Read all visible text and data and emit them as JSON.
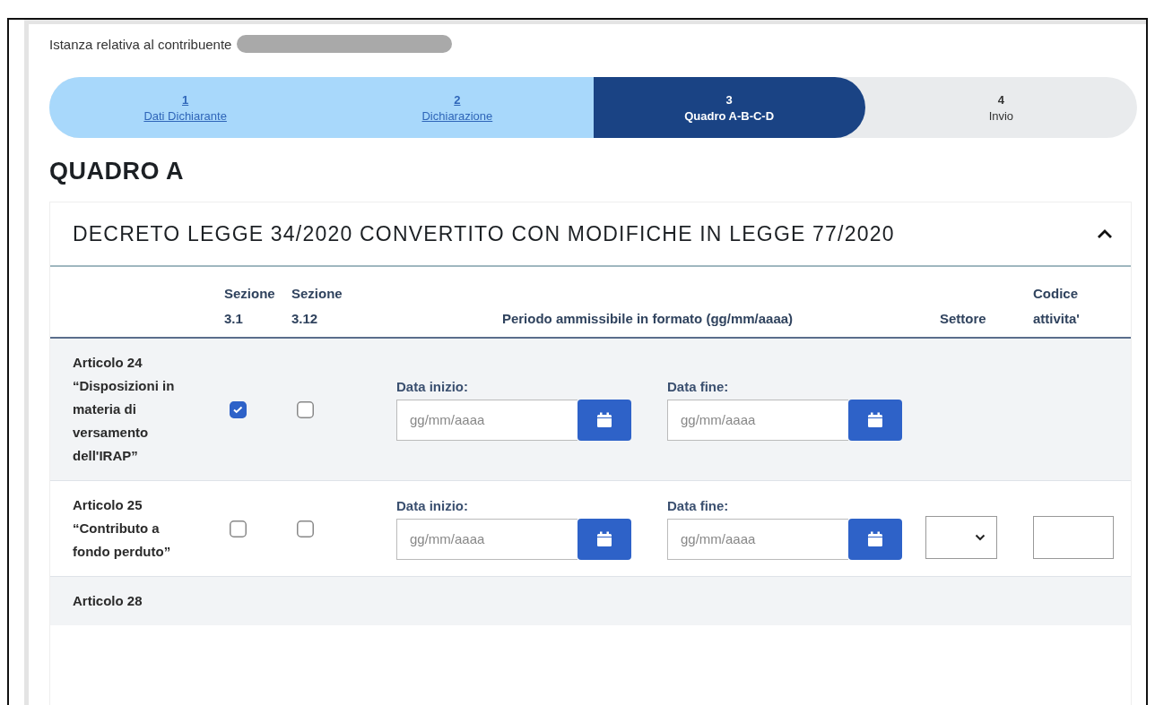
{
  "intro": {
    "label": "Istanza relativa al contribuente",
    "redacted": true
  },
  "steps": [
    {
      "number": "1",
      "label": "Dati Dichiarante",
      "completed": true,
      "selected": false
    },
    {
      "number": "2",
      "label": "Dichiarazione",
      "completed": true,
      "selected": false
    },
    {
      "number": "3",
      "label": "Quadro A-B-C-D",
      "completed": false,
      "selected": true
    },
    {
      "number": "4",
      "label": "Invio",
      "completed": false,
      "selected": false
    }
  ],
  "section_title": "QUADRO A",
  "accordion": {
    "title": "DECRETO LEGGE 34/2020 CONVERTITO CON MODIFICHE IN LEGGE 77/2020",
    "expanded": true
  },
  "table": {
    "columns": [
      "Sezione 3.1",
      "Sezione 3.12",
      "Periodo ammissibile in formato (gg/mm/aaaa)",
      "Settore",
      "Codice attivita'"
    ],
    "rows": [
      {
        "article": "Articolo 24 “Disposizioni in materia di versamento dell'IRAP”",
        "sezione_3_1": {
          "checked": true
        },
        "sezione_3_12": {
          "checked": false
        },
        "start": {
          "label": "Data inizio:",
          "placeholder": "gg/mm/aaaa"
        },
        "end": {
          "label": "Data fine:",
          "placeholder": "gg/mm/aaaa"
        },
        "settore_select": false,
        "codice_field": false
      },
      {
        "article": "Articolo 25 “Contributo a fondo perduto”",
        "sezione_3_1": {
          "checked": false
        },
        "sezione_3_12": {
          "checked": false
        },
        "start": {
          "label": "Data inizio:",
          "placeholder": "gg/mm/aaaa"
        },
        "end": {
          "label": "Data fine:",
          "placeholder": "gg/mm/aaaa"
        },
        "settore_select": true,
        "codice_field": true
      },
      {
        "article": "Articolo 28",
        "settore_select": false,
        "codice_field": false
      }
    ]
  }
}
